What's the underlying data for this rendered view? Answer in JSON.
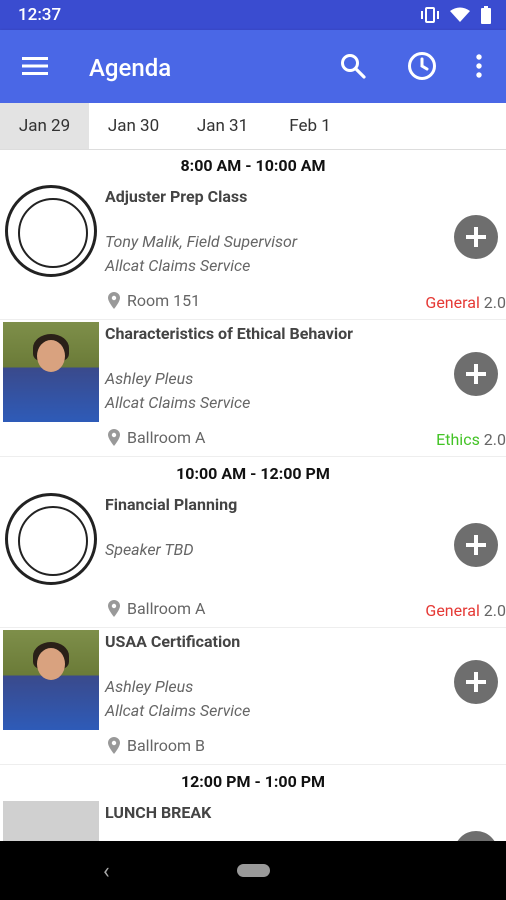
{
  "status": {
    "time": "12:37"
  },
  "appbar": {
    "title": "Agenda"
  },
  "tabs": [
    "Jan 29",
    "Jan 30",
    "Jan 31",
    "Feb 1"
  ],
  "groups": [
    {
      "time_range": "8:00 AM - 10:00 AM",
      "sessions": [
        {
          "title": "Adjuster Prep Class",
          "speaker_line1": "Tony Malik, Field Supervisor",
          "speaker_line2": "Allcat Claims Service",
          "location": "Room 151",
          "track": "General",
          "track_color": "#e53935",
          "credits": "2.0",
          "thumb": "logo"
        },
        {
          "title": "Characteristics of Ethical Behavior",
          "speaker_line1": "Ashley Pleus",
          "speaker_line2": "Allcat Claims Service",
          "location": "Ballroom A",
          "track": "Ethics",
          "track_color": "#43c326",
          "credits": "2.0",
          "thumb": "photo"
        }
      ]
    },
    {
      "time_range": "10:00 AM - 12:00 PM",
      "sessions": [
        {
          "title": "Financial Planning",
          "speaker_line1": "Speaker TBD",
          "speaker_line2": "",
          "location": "Ballroom A",
          "track": "General",
          "track_color": "#e53935",
          "credits": "2.0",
          "thumb": "logo"
        },
        {
          "title": "USAA Certification",
          "speaker_line1": "Ashley Pleus",
          "speaker_line2": "Allcat Claims Service",
          "location": "Ballroom B",
          "track": "",
          "track_color": "#666666",
          "credits": "",
          "thumb": "photo"
        }
      ]
    },
    {
      "time_range": "12:00 PM - 1:00 PM",
      "sessions": [
        {
          "title": "LUNCH BREAK",
          "speaker_line1": "",
          "speaker_line2": "",
          "location": "",
          "track": "",
          "track_color": "#666666",
          "credits": "",
          "thumb": "placeholder"
        }
      ]
    }
  ]
}
